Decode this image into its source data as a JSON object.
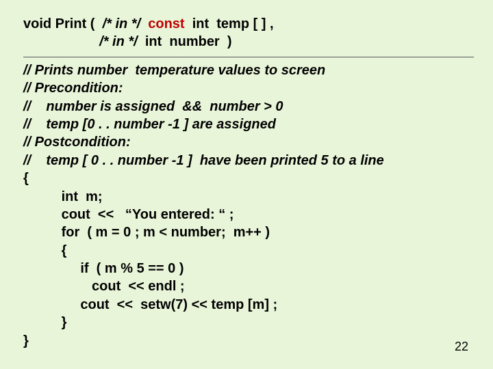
{
  "signature": {
    "part1": "void Print (  ",
    "part2_it": "/* in */",
    "part3_red": "  const",
    "part4": "  int  temp [ ] ,",
    "part5_indent": "                    ",
    "part6_it": "/* in */",
    "part7": "  int  number  )"
  },
  "comments": {
    "c1": "// Prints number  temperature values to screen",
    "c2": "// Precondition:",
    "c3": "//    number is assigned  &&  number > 0",
    "c4": "//    temp [0 . . number -1 ] are assigned",
    "c5": "// Postcondition:",
    "c6": "//    temp [ 0 . . number -1 ]  have been printed 5 to a line"
  },
  "body": {
    "b1": "{",
    "b2": "          int  m;",
    "b3": "          cout  <<   “You entered: “ ;",
    "b4": "          for  ( m = 0 ; m < number;  m++ )",
    "b5": "          {",
    "b6": "               if  ( m % 5 == 0 )",
    "b7": "                  cout  << endl ;",
    "b8": "               cout  <<  setw(7) << temp [m] ;",
    "b9": "          }",
    "b10": "}"
  },
  "page": "22"
}
